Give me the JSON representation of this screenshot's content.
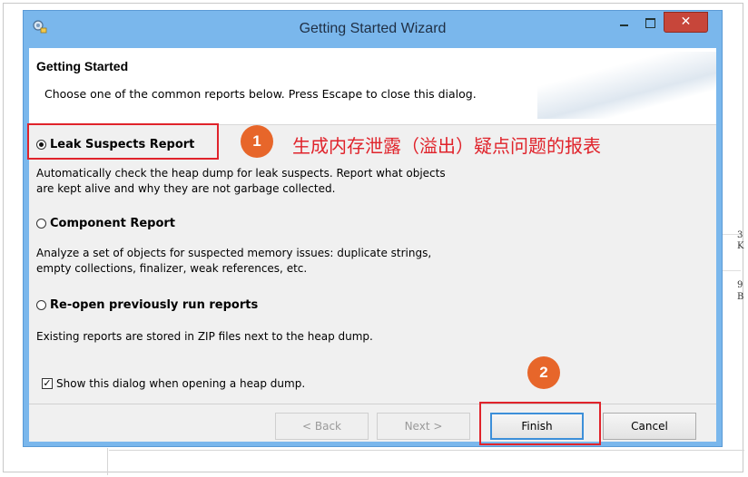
{
  "window": {
    "title": "Getting Started Wizard",
    "close_label": "✕"
  },
  "header": {
    "title": "Getting Started",
    "description": "Choose one of the common reports below. Press Escape to close this dialog."
  },
  "options": [
    {
      "label": "Leak Suspects Report",
      "selected": true,
      "description_lines": [
        "Automatically check the heap dump for leak suspects. Report what objects",
        "are kept alive and why they are not garbage collected."
      ]
    },
    {
      "label": "Component Report",
      "selected": false,
      "description_lines": [
        "Analyze a set of objects for suspected memory issues: duplicate strings,",
        "empty collections, finalizer, weak references, etc."
      ]
    },
    {
      "label": "Re-open previously run reports",
      "selected": false,
      "description_lines": [
        "Existing reports are stored in ZIP files next to the heap dump."
      ]
    }
  ],
  "show_dialog": {
    "label": "Show this dialog when opening a heap dump.",
    "checked": true,
    "check_glyph": "✓"
  },
  "buttons": {
    "back": "< Back",
    "next": "Next >",
    "finish": "Finish",
    "cancel": "Cancel"
  },
  "annotations": {
    "badge_1": "1",
    "badge_2": "2",
    "note_1": "生成内存泄露（溢出）疑点问题的报表"
  },
  "background": {
    "edge_chars": [
      "3",
      "K",
      "9",
      "B"
    ]
  },
  "colors": {
    "titlebar": "#7ab7ec",
    "close_button": "#c7463a",
    "highlight": "#e0232b",
    "badge": "#e7662a",
    "primary_button_border": "#3c8fd9"
  }
}
